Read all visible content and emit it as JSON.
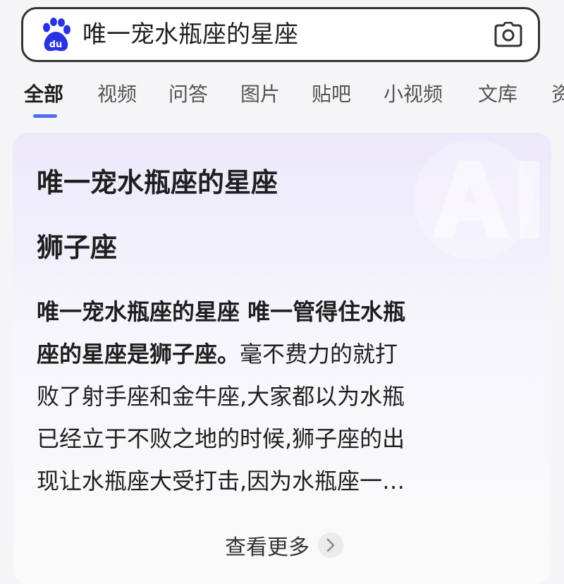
{
  "search": {
    "logo_text": "du",
    "query": "唯一宠水瓶座的星座"
  },
  "tabs": [
    {
      "label": "全部",
      "active": true
    },
    {
      "label": "视频"
    },
    {
      "label": "问答"
    },
    {
      "label": "图片"
    },
    {
      "label": "贴吧"
    },
    {
      "label": "小视频"
    },
    {
      "label": "文库"
    },
    {
      "label": "资"
    }
  ],
  "ai_card": {
    "title": "唯一宠水瓶座的星座",
    "answer": "狮子座",
    "body_lines": [
      {
        "bold": "唯一宠水瓶座的星座 唯一管得住水瓶",
        "rest": ""
      },
      {
        "bold": "座的星座是狮子座。",
        "rest": "毫不费力的就打"
      },
      {
        "bold": "",
        "rest": "败了射手座和金牛座,大家都以为水瓶"
      },
      {
        "bold": "",
        "rest": "已经立于不败之地的时候,狮子座的出"
      },
      {
        "bold": "",
        "rest": "现让水瓶座大受打击,因为水瓶座一…"
      }
    ],
    "see_more": "查看更多"
  },
  "icons": {
    "logo": "baidu-paw-logo",
    "camera": "camera-icon",
    "chevron": "chevron-right-icon"
  },
  "colors": {
    "brand_blue": "#2932e1",
    "tab_underline": "#4e6ef2"
  }
}
